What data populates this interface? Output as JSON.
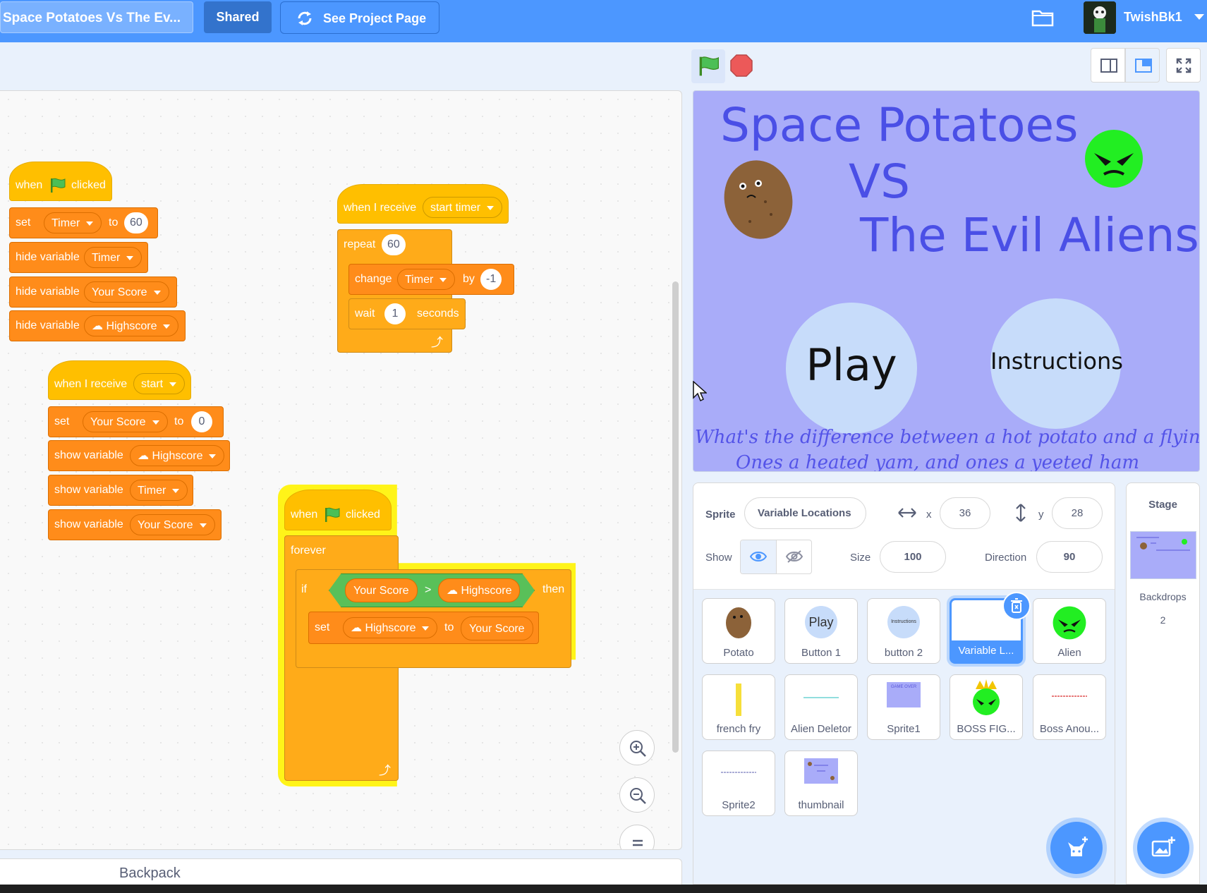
{
  "menu": {
    "project_title": "Space Potatoes Vs The Ev...",
    "shared_label": "Shared",
    "project_page_label": "See Project Page",
    "username": "TwishBk1"
  },
  "code": {
    "script1": {
      "when": "when",
      "clicked": "clicked",
      "set": "set",
      "timer_var": "Timer",
      "to": "to",
      "timer_value": "60",
      "hide1": "hide variable",
      "hide1_var": "Timer",
      "hide2": "hide variable",
      "hide2_var": "Your Score",
      "hide3": "hide variable",
      "hide3_var": "☁ Highscore"
    },
    "script2": {
      "when_receive": "when I receive",
      "message": "start timer",
      "repeat": "repeat",
      "repeat_count": "60",
      "change": "change",
      "change_var": "Timer",
      "by": "by",
      "change_value": "-1",
      "wait": "wait",
      "wait_value": "1",
      "seconds": "seconds",
      "loop_arrow": "⤴"
    },
    "script3": {
      "when_receive": "when I receive",
      "message": "start",
      "set": "set",
      "set_var": "Your Score",
      "to": "to",
      "set_value": "0",
      "show1": "show variable",
      "show1_var": "☁ Highscore",
      "show2": "show variable",
      "show2_var": "Timer",
      "show3": "show variable",
      "show3_var": "Your Score"
    },
    "script4": {
      "when": "when",
      "clicked": "clicked",
      "forever": "forever",
      "if": "if",
      "then": "then",
      "left_operand": "Your Score",
      "operator": ">",
      "right_operand": "☁ Highscore",
      "set": "set",
      "set_var": "☁ Highscore",
      "to": "to",
      "set_value": "Your Score",
      "loop_arrow": "⤴"
    },
    "backpack_label": "Backpack"
  },
  "stage": {
    "title_line1": "Space Potatoes",
    "title_line2": "VS",
    "title_line3": "The Evil Aliens",
    "play_label": "Play",
    "instructions_label": "Instructions",
    "joke_line1": "What's the difference between a hot potato and a flying pig?",
    "joke_line2": "Ones a heated yam, and ones a yeeted ham"
  },
  "sprite_info": {
    "sprite_label": "Sprite",
    "sprite_name": "Variable Locations",
    "x_label": "x",
    "x_value": "36",
    "y_label": "y",
    "y_value": "28",
    "show_label": "Show",
    "size_label": "Size",
    "size_value": "100",
    "direction_label": "Direction",
    "direction_value": "90"
  },
  "sprites": [
    {
      "name": "Potato"
    },
    {
      "name": "Button 1",
      "thumb_text": "Play"
    },
    {
      "name": "button 2",
      "thumb_text": "Instructions"
    },
    {
      "name": "Variable L...",
      "selected": true
    },
    {
      "name": "Alien"
    },
    {
      "name": "french fry"
    },
    {
      "name": "Alien Deletor"
    },
    {
      "name": "Sprite1",
      "thumb_text": "GAME OVER"
    },
    {
      "name": "BOSS FIG..."
    },
    {
      "name": "Boss Anou..."
    },
    {
      "name": "Sprite2"
    },
    {
      "name": "thumbnail"
    }
  ],
  "stage_panel": {
    "label": "Stage",
    "backdrops_label": "Backdrops",
    "backdrops_count": "2"
  },
  "colors": {
    "menu_bar": "#4c97ff",
    "events": "#ffbf00",
    "variables": "#ff8c1a",
    "control": "#ffab19",
    "operators": "#59c059",
    "stage_bg": "#a9acf9"
  }
}
